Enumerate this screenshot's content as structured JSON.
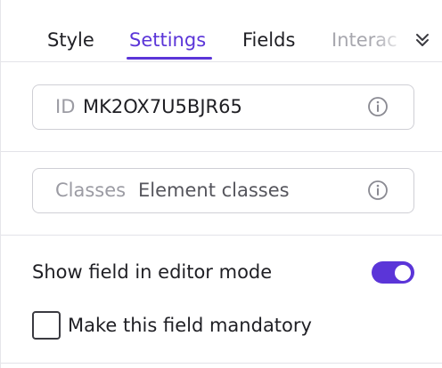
{
  "tabs": {
    "items": [
      {
        "label": "Style",
        "active": false
      },
      {
        "label": "Settings",
        "active": true
      },
      {
        "label": "Fields",
        "active": false
      }
    ],
    "overflow_label": "Interac",
    "overflow_icon": "chevron-double-down-icon"
  },
  "id_field": {
    "prefix": "ID",
    "value": "MK2OX7U5BJR65",
    "icon": "info-icon"
  },
  "classes_field": {
    "prefix": "Classes",
    "placeholder": "Element classes",
    "icon": "info-icon"
  },
  "options": {
    "show_in_editor_label": "Show field in editor mode",
    "show_in_editor_on": true,
    "mandatory_label": "Make this field mandatory",
    "mandatory_checked": false
  },
  "colors": {
    "accent": "#5b35d8",
    "border": "#cfcfd5",
    "muted_text": "#9b9ba3"
  }
}
